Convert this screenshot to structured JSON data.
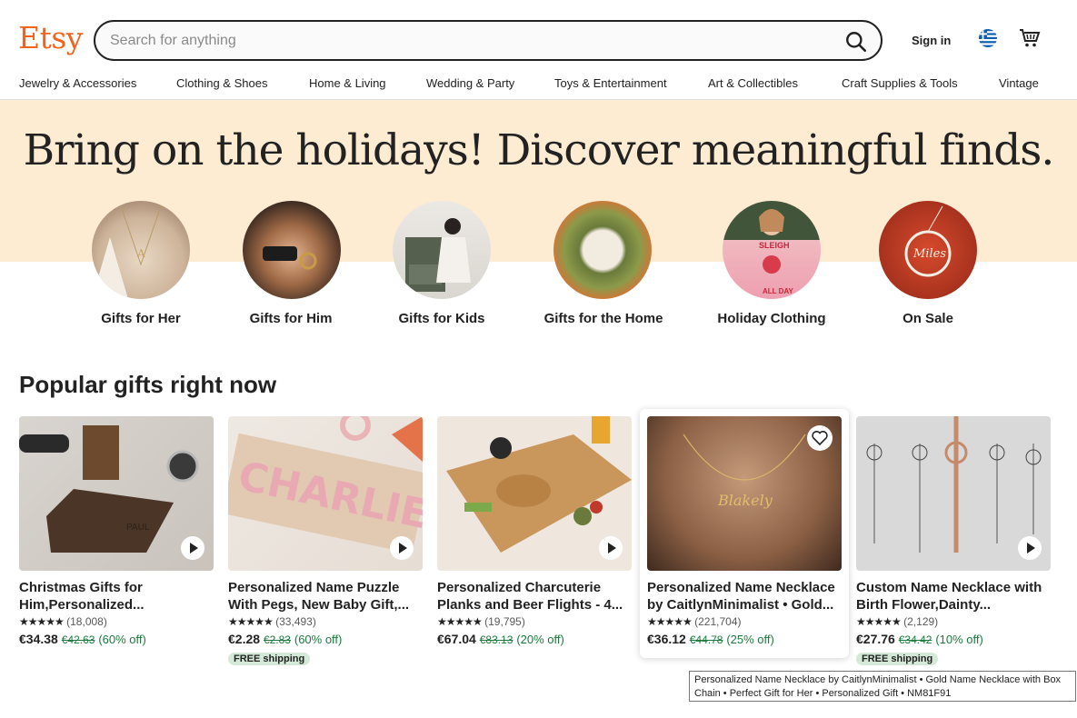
{
  "header": {
    "logo": "Etsy",
    "search_placeholder": "Search for anything",
    "sign_in": "Sign in"
  },
  "categories": [
    "Jewelry & Accessories",
    "Clothing & Shoes",
    "Home & Living",
    "Wedding & Party",
    "Toys & Entertainment",
    "Art & Collectibles",
    "Craft Supplies & Tools",
    "Vintage"
  ],
  "hero": {
    "title": "Bring on the holidays! Discover meaningful finds.",
    "circles": [
      {
        "label": "Gifts for Her"
      },
      {
        "label": "Gifts for Him"
      },
      {
        "label": "Gifts for Kids"
      },
      {
        "label": "Gifts for the Home"
      },
      {
        "label": "Holiday Clothing"
      },
      {
        "label": "On Sale"
      }
    ]
  },
  "popular": {
    "title": "Popular gifts right now",
    "items": [
      {
        "title": "Christmas Gifts for Him,Personalized...",
        "stars": "★★★★★",
        "reviews": "(18,008)",
        "price": "€34.38",
        "original": "€42.63",
        "discount": "(60% off)",
        "free_shipping": ""
      },
      {
        "title": "Personalized Name Puzzle With Pegs, New Baby Gift,...",
        "stars": "★★★★★",
        "reviews": "(33,493)",
        "price": "€2.28",
        "original": "€2.83",
        "discount": "(60% off)",
        "free_shipping": "FREE shipping"
      },
      {
        "title": "Personalized Charcuterie Planks and Beer Flights - 4...",
        "stars": "★★★★★",
        "reviews": "(19,795)",
        "price": "€67.04",
        "original": "€83.13",
        "discount": "(20% off)",
        "free_shipping": ""
      },
      {
        "title": "Personalized Name Necklace by CaitlynMinimalist • Gold...",
        "stars": "★★★★★",
        "reviews": "(221,704)",
        "price": "€36.12",
        "original": "€44.78",
        "discount": "(25% off)",
        "free_shipping": ""
      },
      {
        "title": "Custom Name Necklace with Birth Flower,Dainty...",
        "stars": "★★★★★",
        "reviews": "(2,129)",
        "price": "€27.76",
        "original": "€34.42",
        "discount": "(10% off)",
        "free_shipping": "FREE shipping"
      }
    ]
  },
  "tooltip": "Personalized Name Necklace by CaitlynMinimalist • Gold Name Necklace with Box Chain • Perfect Gift for Her • Personalized Gift • NM81F91",
  "colors": {
    "brand": "#F1641E",
    "hero_bg": "#FDEBD2",
    "sale_green": "#1b7a3c",
    "free_ship_bg": "#D4E9D7"
  }
}
